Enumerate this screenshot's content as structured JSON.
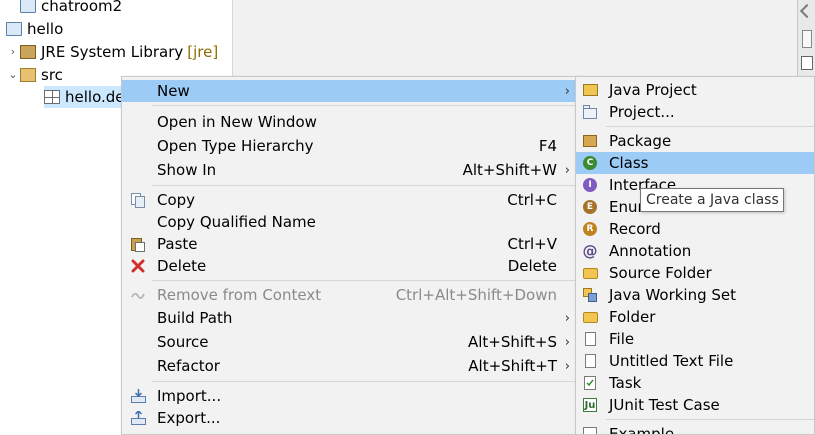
{
  "explorer": {
    "rows": [
      {
        "label": "chatroom2"
      },
      {
        "label": "hello"
      },
      {
        "label": "JRE System Library",
        "decoration": "[jre]"
      },
      {
        "label": "src"
      },
      {
        "label": "hello.de"
      }
    ]
  },
  "menu": {
    "items": [
      {
        "label": "New",
        "accel": "",
        "arrow": "›"
      },
      {
        "label": "Open in New Window",
        "accel": ""
      },
      {
        "label": "Open Type Hierarchy",
        "accel": "F4"
      },
      {
        "label": "Show In",
        "accel": "Alt+Shift+W",
        "arrow": "›"
      },
      {
        "label": "Copy",
        "accel": "Ctrl+C"
      },
      {
        "label": "Copy Qualified Name",
        "accel": ""
      },
      {
        "label": "Paste",
        "accel": "Ctrl+V"
      },
      {
        "label": "Delete",
        "accel": "Delete"
      },
      {
        "label": "Remove from Context",
        "accel": "Ctrl+Alt+Shift+Down"
      },
      {
        "label": "Build Path",
        "accel": "",
        "arrow": "›"
      },
      {
        "label": "Source",
        "accel": "Alt+Shift+S",
        "arrow": "›"
      },
      {
        "label": "Refactor",
        "accel": "Alt+Shift+T",
        "arrow": "›"
      },
      {
        "label": "Import...",
        "accel": ""
      },
      {
        "label": "Export...",
        "accel": ""
      }
    ]
  },
  "submenu": {
    "items": [
      {
        "label": "Java Project"
      },
      {
        "label": "Project..."
      },
      {
        "label": "Package"
      },
      {
        "label": "Class"
      },
      {
        "label": "Interface"
      },
      {
        "label": "Enum"
      },
      {
        "label": "Record"
      },
      {
        "label": "Annotation"
      },
      {
        "label": "Source Folder"
      },
      {
        "label": "Java Working Set"
      },
      {
        "label": "Folder"
      },
      {
        "label": "File"
      },
      {
        "label": "Untitled Text File"
      },
      {
        "label": "Task"
      },
      {
        "label": "JUnit Test Case"
      },
      {
        "label": "Example..."
      }
    ]
  },
  "tooltip": {
    "text": "Create a Java class"
  },
  "colors": {
    "highlight": "#9ccbf6",
    "selection": "#cce8ff",
    "menu_bg": "#f2f2f2"
  }
}
